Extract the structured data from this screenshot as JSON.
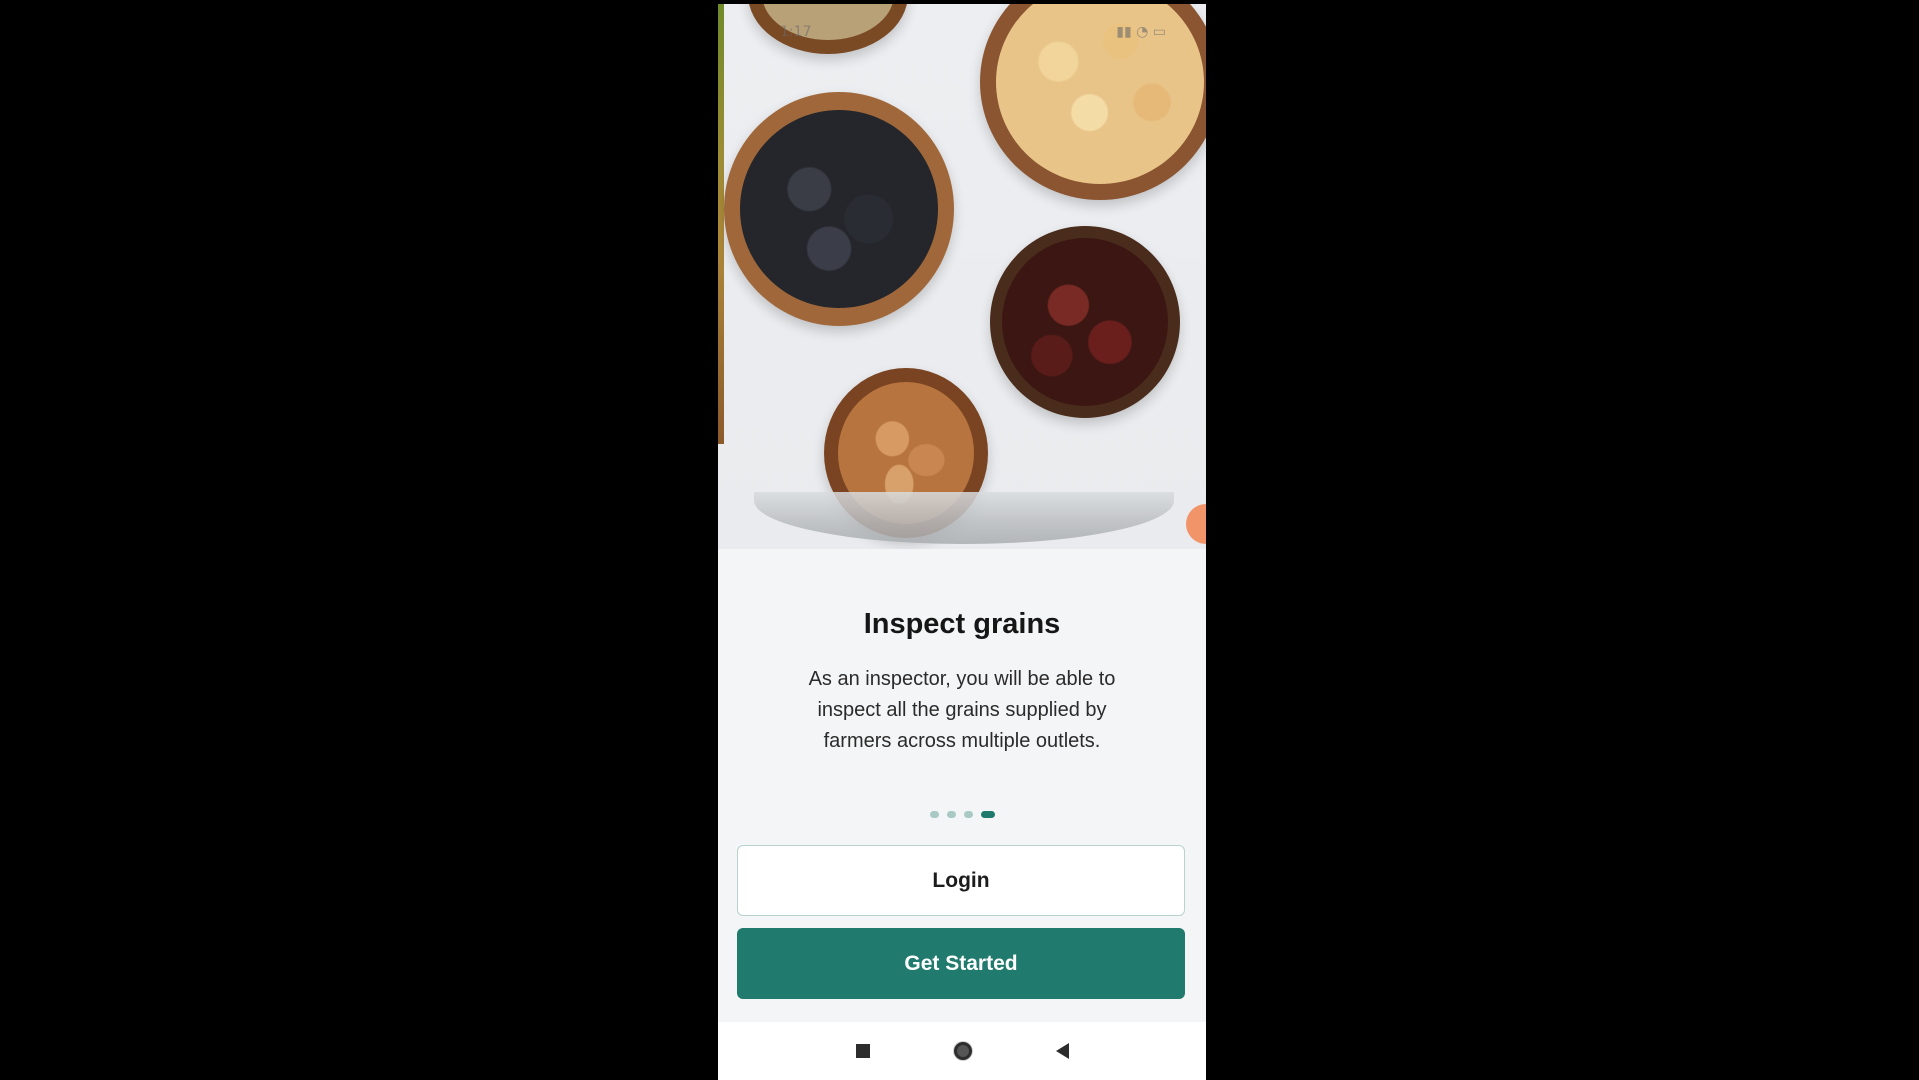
{
  "status_bar": {
    "time": "1:17"
  },
  "onboarding": {
    "title": "Inspect grains",
    "description": "As an inspector, you will be able to inspect all the grains supplied by farmers across multiple outlets.",
    "pager": {
      "total": 4,
      "active_index": 3
    }
  },
  "actions": {
    "login_label": "Login",
    "get_started_label": "Get Started"
  },
  "colors": {
    "accent": "#217a6e",
    "dot_inactive": "#a9c9c4"
  },
  "icons": {
    "nav_recents": "recents-icon",
    "nav_home": "home-icon",
    "nav_back": "back-icon"
  }
}
